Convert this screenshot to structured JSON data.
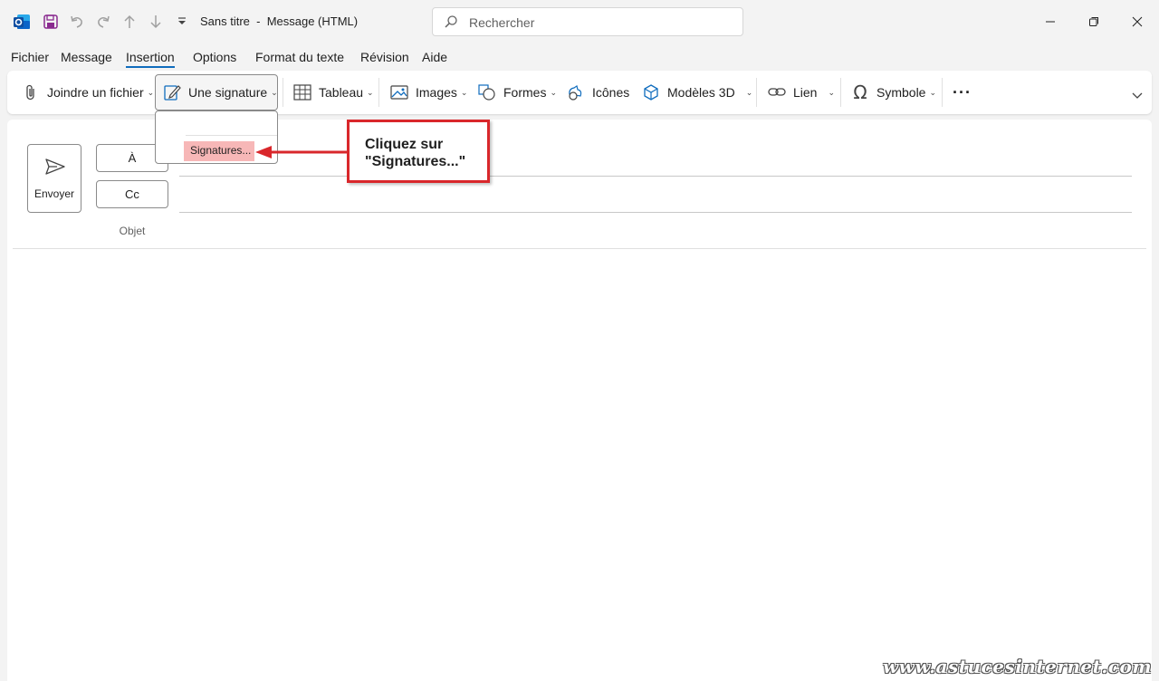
{
  "window": {
    "title": "Sans titre  -  Message (HTML)",
    "search_placeholder": "Rechercher"
  },
  "menu": [
    {
      "label": "Fichier"
    },
    {
      "label": "Message"
    },
    {
      "label": "Insertion",
      "active": true
    },
    {
      "label": "Options"
    },
    {
      "label": "Format du texte"
    },
    {
      "label": "Révision"
    },
    {
      "label": "Aide"
    }
  ],
  "ribbon": {
    "attach": "Joindre un fichier",
    "signature": "Une signature",
    "table": "Tableau",
    "images": "Images",
    "shapes": "Formes",
    "icons": "Icônes",
    "models3d": "Modèles 3D",
    "link": "Lien",
    "symbol": "Symbole",
    "more": "···"
  },
  "dropdown": {
    "item": "Signatures..."
  },
  "compose": {
    "send": "Envoyer",
    "to": "À",
    "cc": "Cc",
    "subject": "Objet"
  },
  "callout": {
    "line1": "Cliquez sur",
    "line2": "\"Signatures...\""
  },
  "watermark": "www.astucesinternet.com",
  "colors": {
    "accent": "#0f6cbd",
    "callout_border": "#d9272b",
    "highlight": "#f7b7b7"
  }
}
